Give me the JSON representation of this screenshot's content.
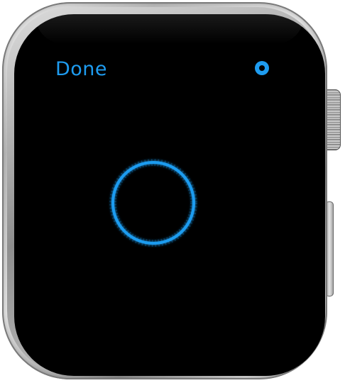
{
  "screen": {
    "done_label": "Done",
    "status_icon": "record-dot-icon",
    "activity_icon": "listening-ring-icon"
  },
  "colors": {
    "accent": "#1e9cf0",
    "screen_background": "#000000"
  }
}
